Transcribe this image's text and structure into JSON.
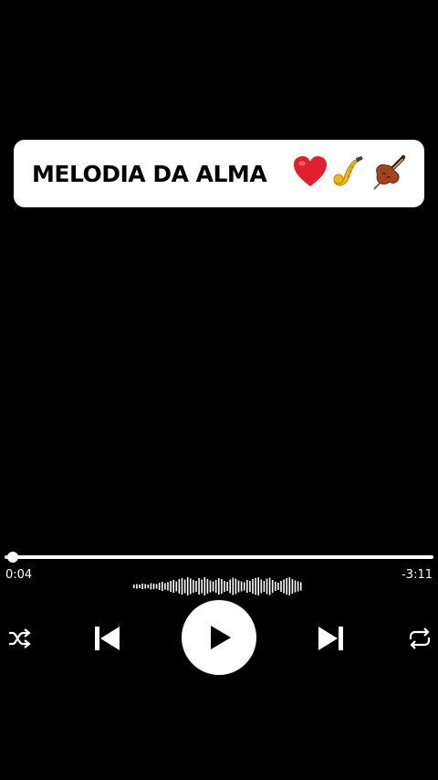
{
  "title_card": {
    "text": "MELODIA DA ALMA",
    "emojis": [
      "heart-icon",
      "saxophone-icon",
      "violin-icon"
    ]
  },
  "player": {
    "elapsed": "0:04",
    "remaining": "-3:11",
    "progress_fraction": 0.02,
    "controls": [
      "shuffle-icon",
      "previous-icon",
      "play-icon",
      "next-icon",
      "repeat-icon"
    ]
  },
  "colors": {
    "background": "#000000",
    "card": "#ffffff",
    "heart": "#e0202f",
    "saxophone": "#f0b81e",
    "violin": "#a0441e"
  }
}
